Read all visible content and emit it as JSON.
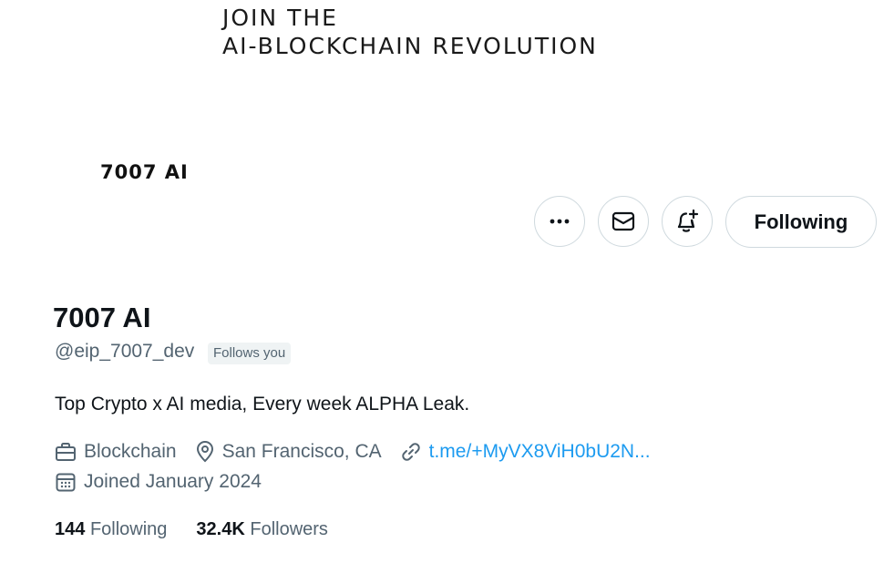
{
  "banner": {
    "line1": "JOIN THE",
    "line2": "AI-BLOCKCHAIN REVOLUTION"
  },
  "avatar": {
    "brand_text": "7007 AI"
  },
  "actions": {
    "more_icon": "ellipsis-icon",
    "message_icon": "mail-icon",
    "notify_icon": "bell-plus-icon",
    "follow_label": "Following"
  },
  "profile": {
    "display_name": "7007 AI",
    "handle": "@eip_7007_dev",
    "follows_you": "Follows you",
    "bio": "Top Crypto x AI media, Every week ALPHA Leak.",
    "category": "Blockchain",
    "location": "San Francisco, CA",
    "link": "t.me/+MyVX8ViH0bU2N...",
    "joined": "Joined January 2024"
  },
  "stats": {
    "following_count": "144",
    "following_label": "Following",
    "followers_count": "32.4K",
    "followers_label": "Followers"
  },
  "colors": {
    "text_primary": "#0f1419",
    "text_secondary": "#536471",
    "link": "#1d9bf0",
    "border": "#cfd9de",
    "badge_bg": "#eff3f4"
  }
}
